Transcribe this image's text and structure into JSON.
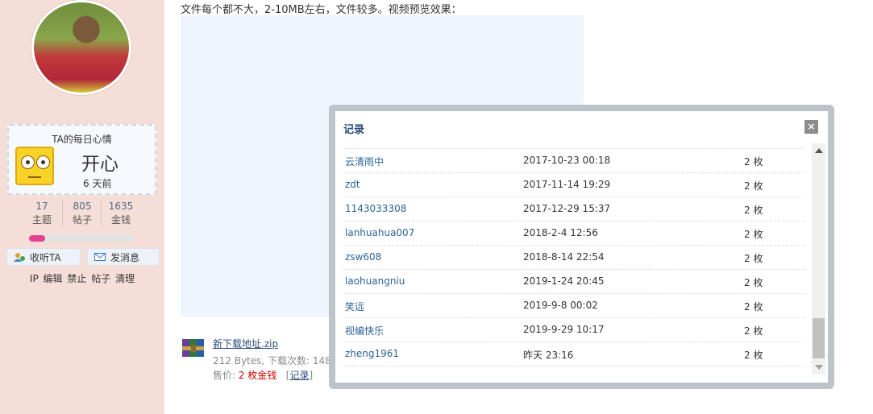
{
  "sidebar": {
    "mood": {
      "title": "TA的每日心情",
      "text": "开心",
      "time": "6 天前",
      "icon": "smiley-face-icon"
    },
    "stats": [
      {
        "num": "17",
        "label": "主题"
      },
      {
        "num": "805",
        "label": "帖子"
      },
      {
        "num": "1635",
        "label": "金钱"
      }
    ],
    "progress_fraction": 0.15,
    "follow_label": "收听TA",
    "message_label": "发消息",
    "admin_links": [
      "IP",
      "编辑",
      "禁止",
      "帖子",
      "清理"
    ]
  },
  "main": {
    "intro": "文件每个都不大，2-10MB左右，文件较多。视频预览效果：",
    "attachment": {
      "name": "新下载地址.zip",
      "meta": "212 Bytes, 下载次数: 148",
      "price_prefix": "售价: ",
      "price_value": "2 枚金钱",
      "record_link": "记录"
    }
  },
  "modal": {
    "title": "记录",
    "close": "×",
    "rows": [
      {
        "name": "云清雨中",
        "time": "2017-10-23 00:18",
        "amount": "2 枚"
      },
      {
        "name": "zdt",
        "time": "2017-11-14 19:29",
        "amount": "2 枚"
      },
      {
        "name": "1143033308",
        "time": "2017-12-29 15:37",
        "amount": "2 枚"
      },
      {
        "name": "lanhuahua007",
        "time": "2018-2-4 12:56",
        "amount": "2 枚"
      },
      {
        "name": "zsw608",
        "time": "2018-8-14 22:54",
        "amount": "2 枚"
      },
      {
        "name": "laohuangniu",
        "time": "2019-1-24 20:45",
        "amount": "2 枚"
      },
      {
        "name": "笑远",
        "time": "2019-9-8 00:02",
        "amount": "2 枚"
      },
      {
        "name": "视编快乐",
        "time": "2019-9-29 10:17",
        "amount": "2 枚"
      },
      {
        "name": "zheng1961",
        "time": "昨天 23:16",
        "amount": "2 枚"
      }
    ]
  }
}
